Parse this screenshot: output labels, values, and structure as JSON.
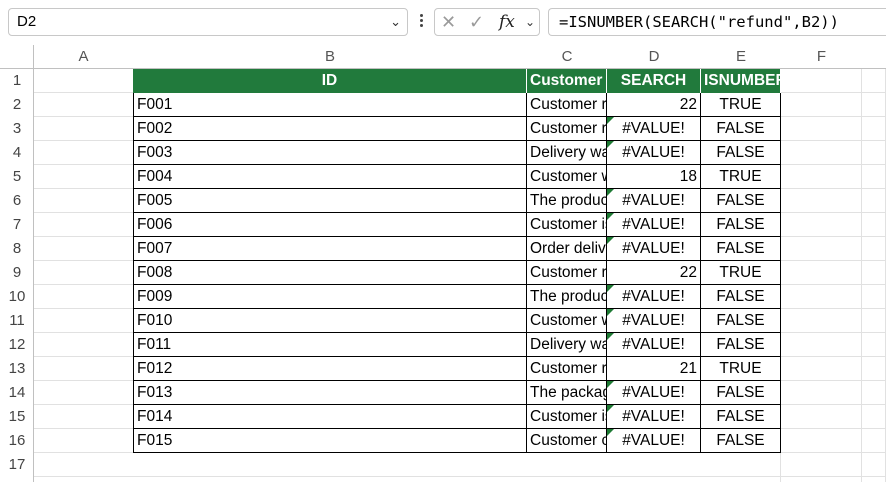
{
  "name_box": {
    "value": "D2",
    "chevron_icon": "chevron-down"
  },
  "formula_bar": {
    "cancel_icon": "cancel-x",
    "enter_icon": "checkmark",
    "function_label": "fx",
    "formula": "=ISNUMBER(SEARCH(\"refund\",B2))"
  },
  "columns": [
    "A",
    "B",
    "C",
    "D",
    "E",
    "F"
  ],
  "header_row": {
    "id": "ID",
    "feedback": "Customer Feedback",
    "search": "SEARCH",
    "isnumber": "ISNUMBER"
  },
  "header_fill_color": "#217a3c",
  "error_indicator_color": "#1e7b34",
  "rows": [
    {
      "num": "1"
    },
    {
      "num": "2",
      "id": "F001",
      "feedback": "Customer requested a refund",
      "search": "22",
      "isnumber": "TRUE"
    },
    {
      "num": "3",
      "id": "F002",
      "feedback": "Customer received the wrong item",
      "search": "#VALUE!",
      "isnumber": "FALSE"
    },
    {
      "num": "4",
      "id": "F003",
      "feedback": "Delivery was very fast",
      "search": "#VALUE!",
      "isnumber": "FALSE"
    },
    {
      "num": "5",
      "id": "F004",
      "feedback": "Customer wants a refund",
      "search": "18",
      "isnumber": "TRUE"
    },
    {
      "num": "6",
      "id": "F005",
      "feedback": "The product arrived damaged",
      "search": "#VALUE!",
      "isnumber": "FALSE"
    },
    {
      "num": "7",
      "id": "F006",
      "feedback": "Customer is happy with the service",
      "search": "#VALUE!",
      "isnumber": "FALSE"
    },
    {
      "num": "8",
      "id": "F007",
      "feedback": "Order delivery was delayed",
      "search": "#VALUE!",
      "isnumber": "FALSE"
    },
    {
      "num": "9",
      "id": "F008",
      "feedback": "Customer requested a refund yesterday",
      "search": "22",
      "isnumber": "TRUE"
    },
    {
      "num": "10",
      "id": "F009",
      "feedback": "The product quality is excellent",
      "search": "#VALUE!",
      "isnumber": "FALSE"
    },
    {
      "num": "11",
      "id": "F010",
      "feedback": "Customer wants to return the product",
      "search": "#VALUE!",
      "isnumber": "FALSE"
    },
    {
      "num": "12",
      "id": "F011",
      "feedback": "Delivery was late",
      "search": "#VALUE!",
      "isnumber": "FALSE"
    },
    {
      "num": "13",
      "id": "F012",
      "feedback": "Customer received a refund",
      "search": "21",
      "isnumber": "TRUE"
    },
    {
      "num": "14",
      "id": "F013",
      "feedback": "The package was damaged",
      "search": "#VALUE!",
      "isnumber": "FALSE"
    },
    {
      "num": "15",
      "id": "F014",
      "feedback": "Customer is satisfied with the purchase",
      "search": "#VALUE!",
      "isnumber": "FALSE"
    },
    {
      "num": "16",
      "id": "F015",
      "feedback": "Customer complained about poor service",
      "search": "#VALUE!",
      "isnumber": "FALSE"
    },
    {
      "num": "17"
    }
  ]
}
